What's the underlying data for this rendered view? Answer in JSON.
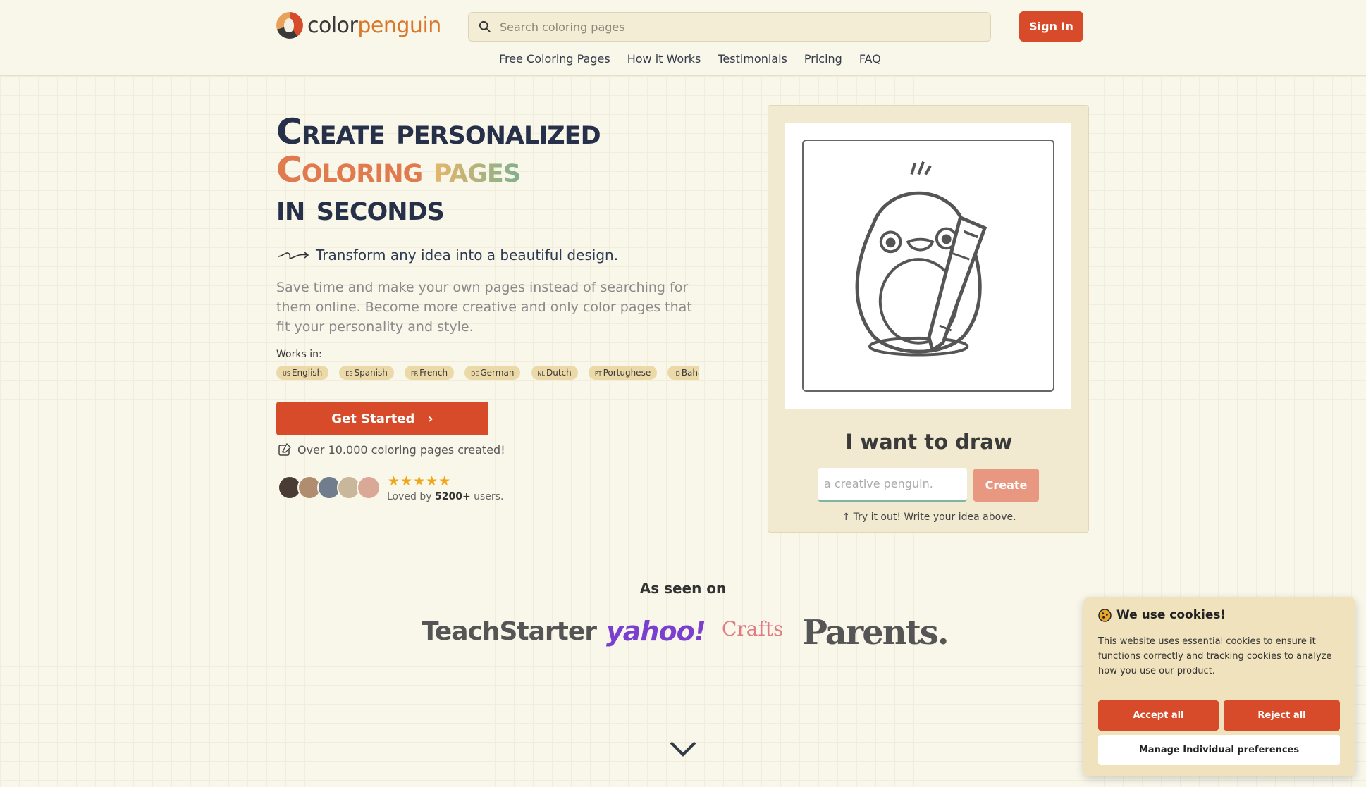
{
  "header": {
    "logo": {
      "part1": "color",
      "part2": "penguin"
    },
    "search_placeholder": "Search coloring pages",
    "signin_label": "Sign In",
    "nav": [
      "Free Coloring Pages",
      "How it Works",
      "Testimonials",
      "Pricing",
      "FAQ"
    ]
  },
  "hero": {
    "title_line1": "Create personalized",
    "title_line2a": "Coloring",
    "title_line2b": "pages",
    "title_line3": "in seconds",
    "subtitle": "Transform any idea into a beautiful design.",
    "description": "Save time and make your own pages instead of searching for them online. Become more creative and only color pages that fit your personality and style.",
    "works_in_label": "Works in:",
    "languages": [
      {
        "code": "US",
        "name": "English"
      },
      {
        "code": "ES",
        "name": "Spanish"
      },
      {
        "code": "FR",
        "name": "French"
      },
      {
        "code": "DE",
        "name": "German"
      },
      {
        "code": "NL",
        "name": "Dutch"
      },
      {
        "code": "PT",
        "name": "Portughese"
      },
      {
        "code": "ID",
        "name": "Baha"
      }
    ],
    "cta_label": "Get Started",
    "created_text": "Over 10.000 coloring pages created!",
    "stars": 5,
    "stars_text": "★★★★★",
    "loved_prefix": "Loved by",
    "loved_count": "5200+",
    "loved_suffix": "users."
  },
  "demo": {
    "heading": "I want to draw",
    "input_placeholder": "a creative penguin.",
    "create_label": "Create",
    "hint": "Try it out! Write your idea above."
  },
  "seen_on": {
    "title": "As seen on",
    "brands": [
      "TeachStarter",
      "yahoo!",
      "Crafts",
      "Parents."
    ]
  },
  "cookie": {
    "title": "We use cookies!",
    "text": "This website uses essential cookies to ensure it functions correctly and tracking cookies to analyze how you use our product.",
    "accept": "Accept all",
    "reject": "Reject all",
    "manage": "Manage Individual preferences"
  },
  "colors": {
    "accent": "#d74b2a",
    "background": "#f9f6ea",
    "card": "#f2ead0",
    "cookie_bg": "#f0e2bc",
    "star": "#f0a61a"
  }
}
